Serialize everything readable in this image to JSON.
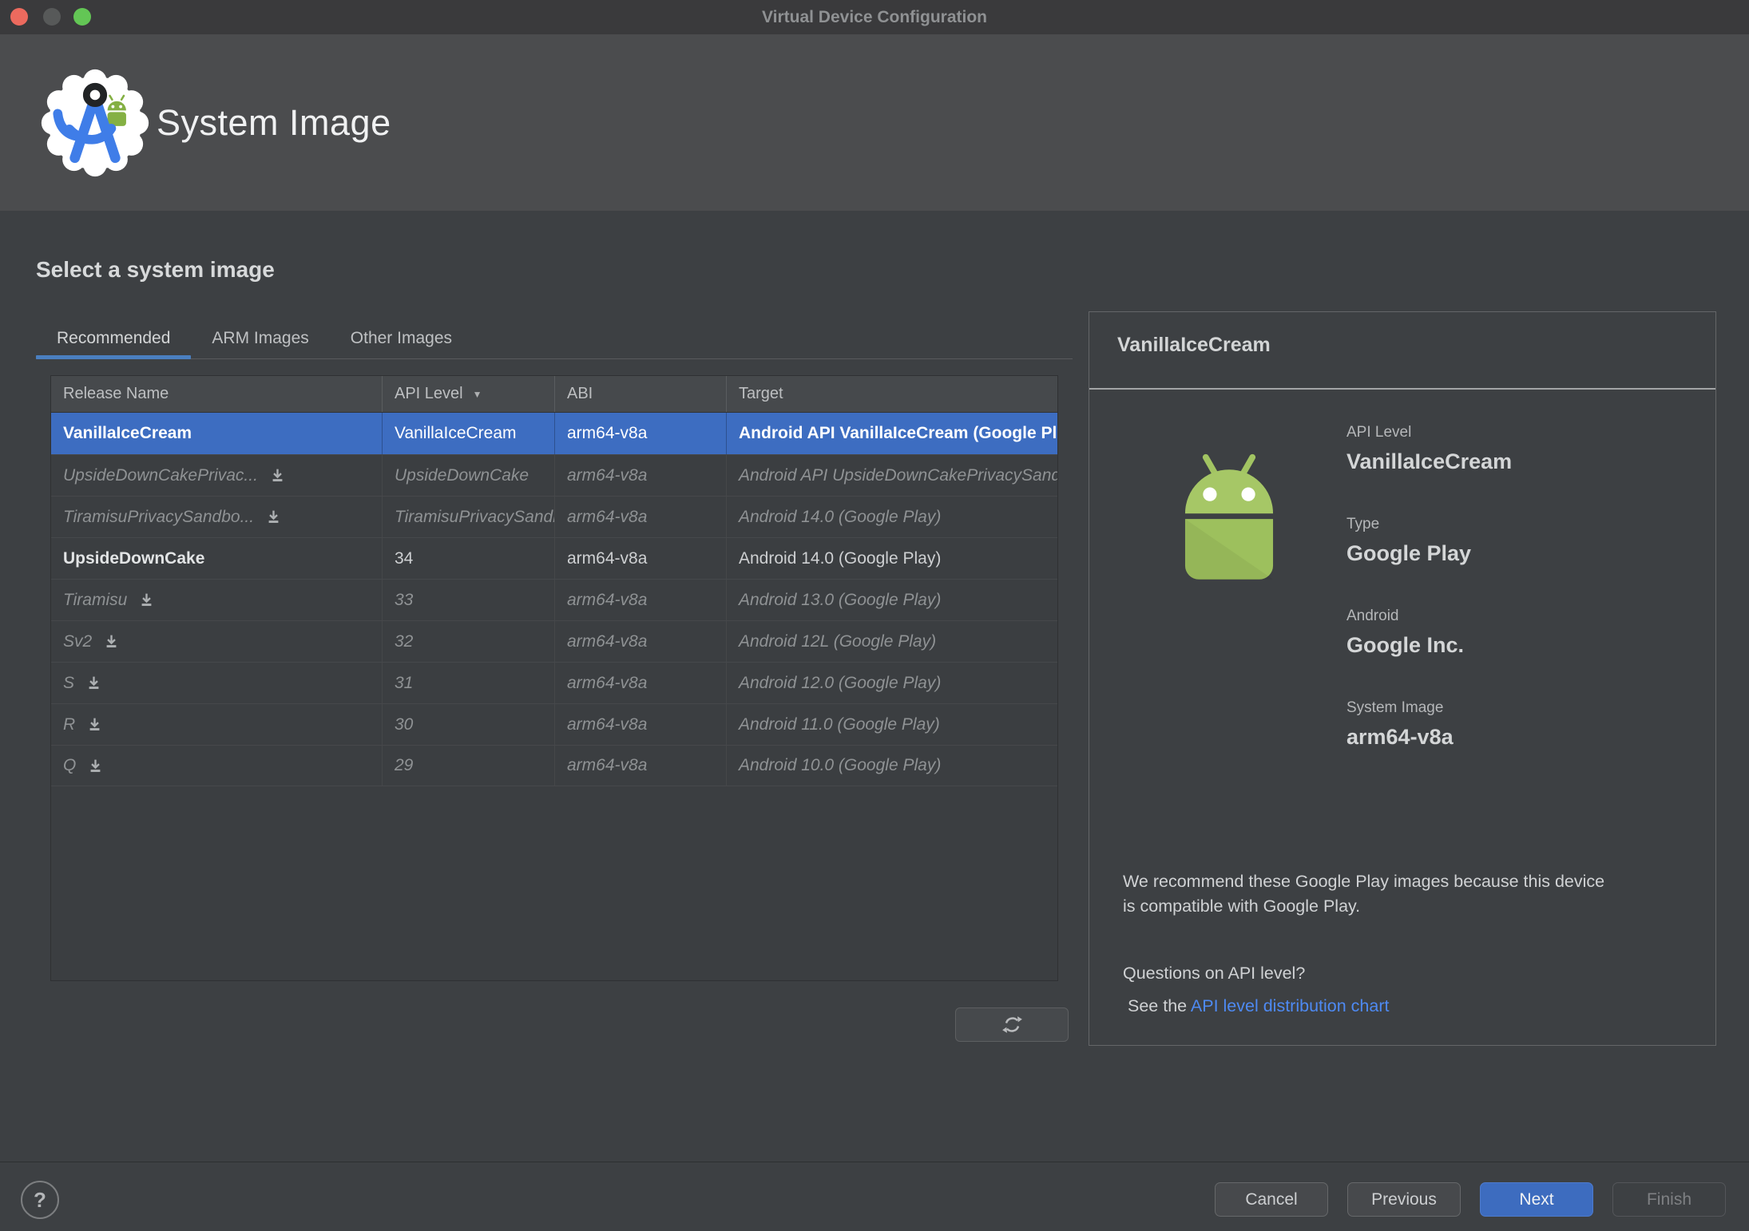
{
  "window": {
    "title": "Virtual Device Configuration"
  },
  "banner": {
    "title": "System Image",
    "logo": "android-studio-logo"
  },
  "content": {
    "heading": "Select a system image",
    "tabs": [
      {
        "label": "Recommended",
        "active": true
      },
      {
        "label": "ARM Images",
        "active": false
      },
      {
        "label": "Other Images",
        "active": false
      }
    ],
    "table": {
      "columns": [
        "Release Name",
        "API Level",
        "ABI",
        "Target"
      ],
      "sort_column_index": 1,
      "sort_indicator": "▼",
      "rows": [
        {
          "release": "VanillaIceCream",
          "api": "VanillaIceCream",
          "abi": "arm64-v8a",
          "target": "Android API VanillaIceCream (Google Play)",
          "selected": true,
          "installed": true,
          "download": false
        },
        {
          "release": "UpsideDownCakePrivac...",
          "api": "UpsideDownCake",
          "abi": "arm64-v8a",
          "target": "Android API UpsideDownCakePrivacySandbox (Google Play)",
          "selected": false,
          "installed": false,
          "download": true
        },
        {
          "release": "TiramisuPrivacySandbo...",
          "api": "TiramisuPrivacySandbox",
          "abi": "arm64-v8a",
          "target": "Android 14.0 (Google Play)",
          "selected": false,
          "installed": false,
          "download": true
        },
        {
          "release": "UpsideDownCake",
          "api": "34",
          "abi": "arm64-v8a",
          "target": "Android 14.0 (Google Play)",
          "selected": false,
          "installed": true,
          "download": false
        },
        {
          "release": "Tiramisu",
          "api": "33",
          "abi": "arm64-v8a",
          "target": "Android 13.0 (Google Play)",
          "selected": false,
          "installed": false,
          "download": true
        },
        {
          "release": "Sv2",
          "api": "32",
          "abi": "arm64-v8a",
          "target": "Android 12L (Google Play)",
          "selected": false,
          "installed": false,
          "download": true
        },
        {
          "release": "S",
          "api": "31",
          "abi": "arm64-v8a",
          "target": "Android 12.0 (Google Play)",
          "selected": false,
          "installed": false,
          "download": true
        },
        {
          "release": "R",
          "api": "30",
          "abi": "arm64-v8a",
          "target": "Android 11.0 (Google Play)",
          "selected": false,
          "installed": false,
          "download": true
        },
        {
          "release": "Q",
          "api": "29",
          "abi": "arm64-v8a",
          "target": "Android 10.0 (Google Play)",
          "selected": false,
          "installed": false,
          "download": true
        }
      ]
    }
  },
  "details": {
    "title": "VanillaIceCream",
    "fields": [
      {
        "label": "API Level",
        "value": "VanillaIceCream"
      },
      {
        "label": "Type",
        "value": "Google Play"
      },
      {
        "label": "Android",
        "value": "Google Inc."
      },
      {
        "label": "System Image",
        "value": "arm64-v8a"
      }
    ],
    "recommendation": "We recommend these Google Play images because this device is compatible with Google Play.",
    "question": "Questions on API level?",
    "see_prefix": "See the ",
    "link_label": "API level distribution chart"
  },
  "footer": {
    "help_label": "?",
    "buttons": [
      {
        "label": "Cancel",
        "style": "normal"
      },
      {
        "label": "Previous",
        "style": "normal"
      },
      {
        "label": "Next",
        "style": "primary"
      },
      {
        "label": "Finish",
        "style": "disabled"
      }
    ]
  },
  "colors": {
    "selection_blue": "#3d6dc1",
    "primary_button_blue": "#3d6cbf",
    "tab_underline_blue": "#4a7fc0",
    "link_blue": "#4e8af3",
    "android_green": "#a0c35f",
    "traffic_red": "#ec6a5e",
    "traffic_gray": "#575959",
    "traffic_green": "#63c655"
  }
}
